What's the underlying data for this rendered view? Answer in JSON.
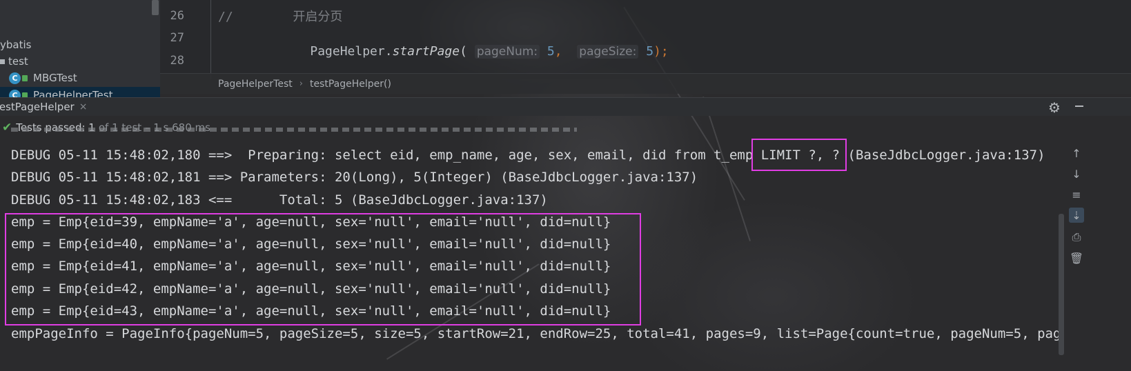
{
  "project_tree": {
    "items": [
      {
        "label": "ybatis",
        "kind": "module"
      },
      {
        "label": "test",
        "kind": "folder"
      },
      {
        "label": "MBGTest",
        "kind": "class"
      },
      {
        "label": "PageHelperTest",
        "kind": "class"
      }
    ]
  },
  "editor": {
    "line_numbers": [
      "26",
      "27",
      "28"
    ],
    "comment": "//        开启分页",
    "call": {
      "receiver": "PageHelper.",
      "method": "startPage",
      "open_paren": "(",
      "hint1": "pageNum:",
      "arg1": "5",
      "comma": ",",
      "hint2": "pageSize:",
      "arg2": "5",
      "close": ");"
    },
    "breadcrumb": [
      "PageHelperTest",
      "testPageHelper()"
    ]
  },
  "run_window": {
    "tab_label": "testPageHelper",
    "close_glyph": "×",
    "status_main": "Tests passed: 1",
    "status_sub": "of 1 test – 1 s 680 ms"
  },
  "console": {
    "lines": [
      "DEBUG 05-11 15:48:02,180 ==>  Preparing: select eid, emp_name, age, sex, email, did from t_emp LIMIT ?, ? (BaseJdbcLogger.java:137)",
      "DEBUG 05-11 15:48:02,181 ==> Parameters: 20(Long), 5(Integer) (BaseJdbcLogger.java:137)",
      "DEBUG 05-11 15:48:02,183 <==      Total: 5 (BaseJdbcLogger.java:137)",
      "emp = Emp{eid=39, empName='a', age=null, sex='null', email='null', did=null}",
      "emp = Emp{eid=40, empName='a', age=null, sex='null', email='null', did=null}",
      "emp = Emp{eid=41, empName='a', age=null, sex='null', email='null', did=null}",
      "emp = Emp{eid=42, empName='a', age=null, sex='null', email='null', did=null}",
      "emp = Emp{eid=43, empName='a', age=null, sex='null', email='null', did=null}",
      "empPageInfo = PageInfo{pageNum=5, pageSize=5, size=5, startRow=21, endRow=25, total=41, pages=9, list=Page{count=true, pageNum=5, pag"
    ],
    "highlight_color": "#e03de3"
  },
  "colors": {
    "background": "#2b2b2d",
    "console_text": "#d7d9dc",
    "success": "#5fb35f"
  }
}
